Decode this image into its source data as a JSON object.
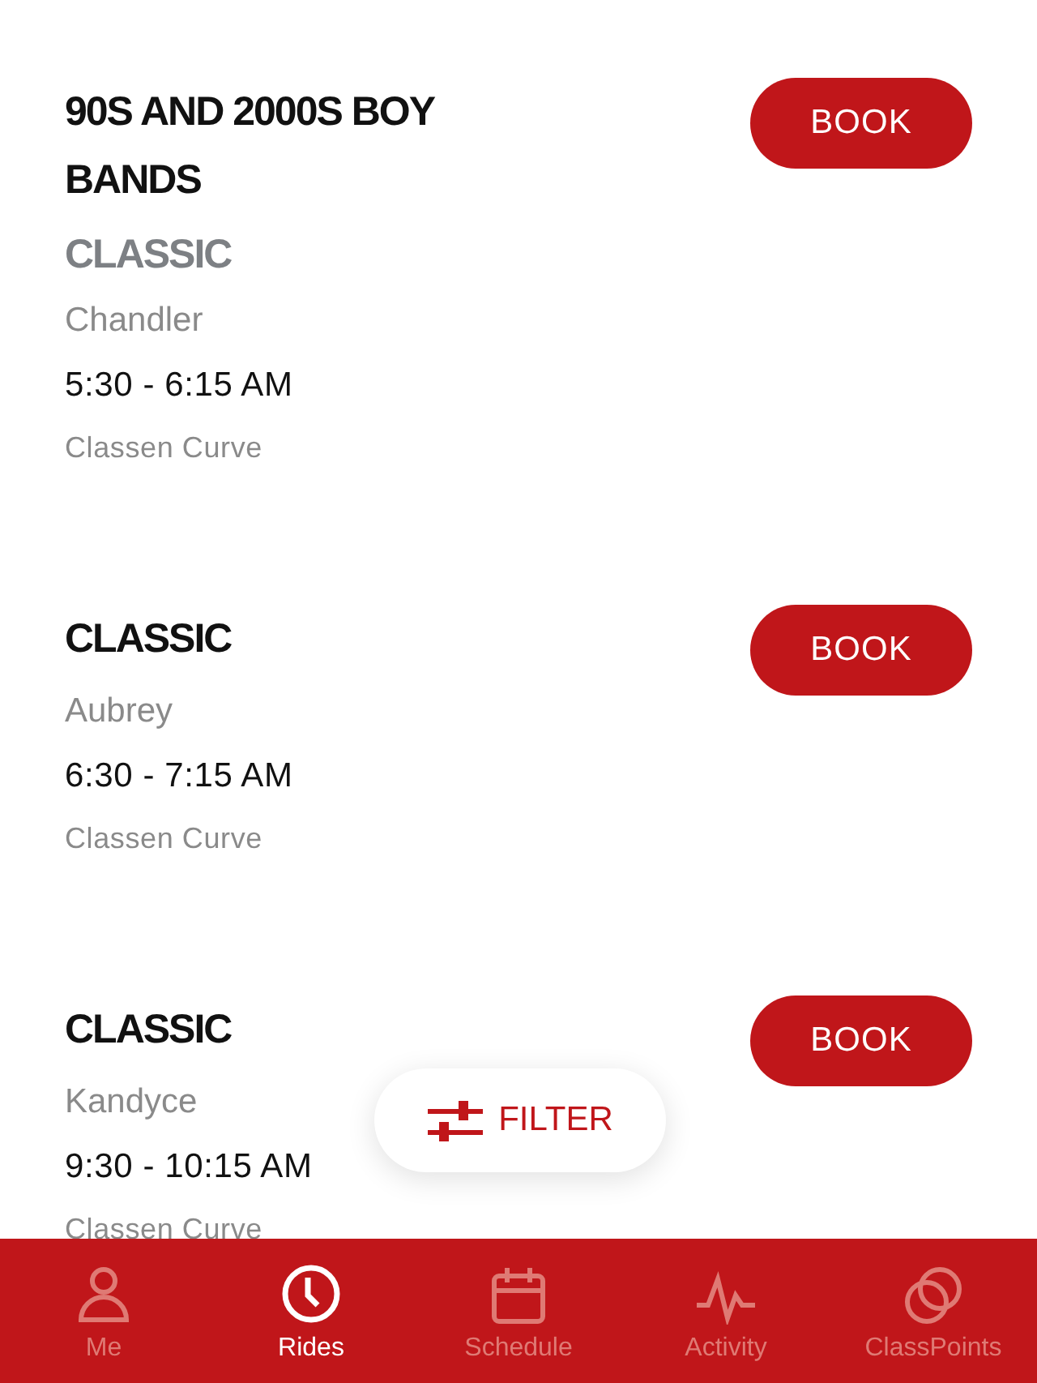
{
  "classes": [
    {
      "title": "90S AND 2000S BOY BANDS",
      "type": "CLASSIC",
      "instructor": "Chandler",
      "time": "5:30 - 6:15 AM",
      "location": "Classen Curve",
      "button": "BOOK"
    },
    {
      "title": "CLASSIC",
      "instructor": "Aubrey",
      "time": "6:30 - 7:15 AM",
      "location": "Classen Curve",
      "button": "BOOK"
    },
    {
      "title": "CLASSIC",
      "instructor": "Kandyce",
      "time": "9:30 - 10:15 AM",
      "location": "Classen Curve",
      "button": "BOOK"
    }
  ],
  "filter_button": {
    "label": "FILTER"
  },
  "tab_bar": [
    {
      "label": "Me",
      "selected": false
    },
    {
      "label": "Rides",
      "selected": true
    },
    {
      "label": "Schedule",
      "selected": false
    },
    {
      "label": "Activity",
      "selected": false
    },
    {
      "label": "ClassPoints",
      "selected": false
    }
  ]
}
